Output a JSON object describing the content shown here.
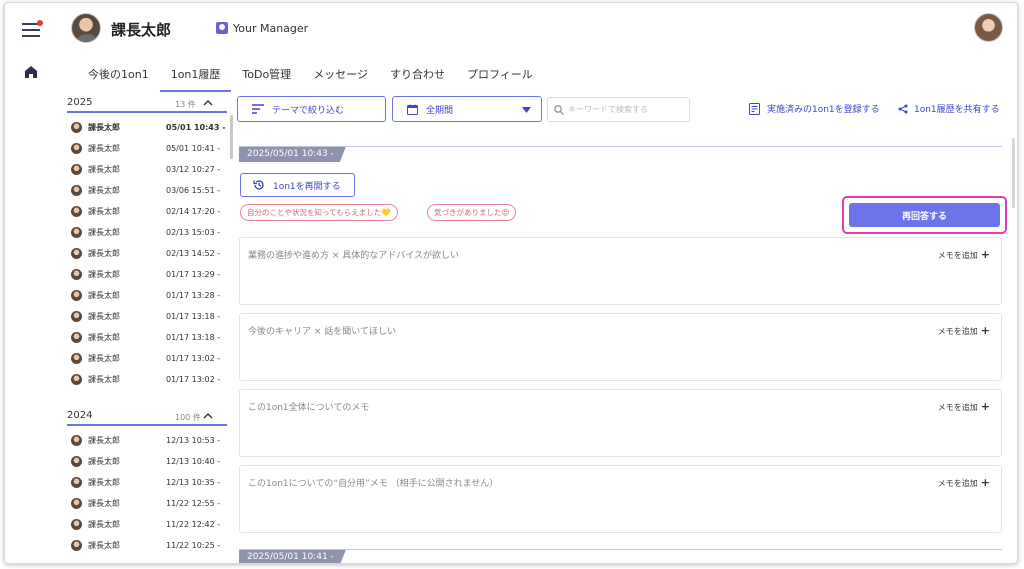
{
  "header": {
    "user_name": "課長太郎",
    "manager_label": "Your Manager"
  },
  "tabs": [
    {
      "label": "今後の1on1"
    },
    {
      "label": "1on1履歴"
    },
    {
      "label": "ToDo管理"
    },
    {
      "label": "メッセージ"
    },
    {
      "label": "すり合わせ"
    },
    {
      "label": "プロフィール"
    }
  ],
  "active_tab": "1on1履歴",
  "sidebar": {
    "groups": [
      {
        "year": "2025",
        "count": "13 件",
        "items": [
          {
            "name": "課長太郎",
            "date": "05/01 10:43 -"
          },
          {
            "name": "課長太郎",
            "date": "05/01 10:41 -"
          },
          {
            "name": "課長太郎",
            "date": "03/12 10:27 -"
          },
          {
            "name": "課長太郎",
            "date": "03/06 15:51 -"
          },
          {
            "name": "課長太郎",
            "date": "02/14 17:20 -"
          },
          {
            "name": "課長太郎",
            "date": "02/13 15:03 -"
          },
          {
            "name": "課長太郎",
            "date": "02/13 14:52 -"
          },
          {
            "name": "課長太郎",
            "date": "01/17 13:29 -"
          },
          {
            "name": "課長太郎",
            "date": "01/17 13:28 -"
          },
          {
            "name": "課長太郎",
            "date": "01/17 13:18 -"
          },
          {
            "name": "課長太郎",
            "date": "01/17 13:18 -"
          },
          {
            "name": "課長太郎",
            "date": "01/17 13:02 -"
          },
          {
            "name": "課長太郎",
            "date": "01/17 13:02 -"
          }
        ]
      },
      {
        "year": "2024",
        "count": "100 件",
        "items": [
          {
            "name": "課長太郎",
            "date": "12/13 10:53 -"
          },
          {
            "name": "課長太郎",
            "date": "12/13 10:40 -"
          },
          {
            "name": "課長太郎",
            "date": "12/13 10:35 -"
          },
          {
            "name": "課長太郎",
            "date": "11/22 12:55 -"
          },
          {
            "name": "課長太郎",
            "date": "11/22 12:42 -"
          },
          {
            "name": "課長太郎",
            "date": "11/22 10:25 -"
          }
        ]
      }
    ]
  },
  "toolbar": {
    "theme_filter": "テーマで絞り込む",
    "period": "全期間",
    "search_placeholder": "キーワードで検索する",
    "register_link": "実施済みの1on1を登録する",
    "share_link": "1on1履歴を共有する"
  },
  "session": {
    "datetime": "2025/05/01 10:43 -",
    "resume_label": "1on1を再開する",
    "chips": [
      "自分のことや状況を知ってもらえました💛",
      "気づきがありました😍"
    ],
    "reanswer_label": "再回答する",
    "memos": [
      {
        "title": "業務の進捗や進め方 × 具体的なアドバイスが欲しい",
        "add_label": "メモを追加"
      },
      {
        "title": "今後のキャリア × 話を聞いてほしい",
        "add_label": "メモを追加"
      },
      {
        "title": "この1on1全体についてのメモ",
        "add_label": "メモを追加"
      },
      {
        "title": "この1on1についての“自分用”メモ （相手に公開されません）",
        "add_label": "メモを追加"
      }
    ]
  },
  "next_session": {
    "datetime": "2025/05/01 10:41 -"
  },
  "colors": {
    "accent": "#6b75e8",
    "highlight": "#e33bb6",
    "chip": "#e68a9a"
  }
}
